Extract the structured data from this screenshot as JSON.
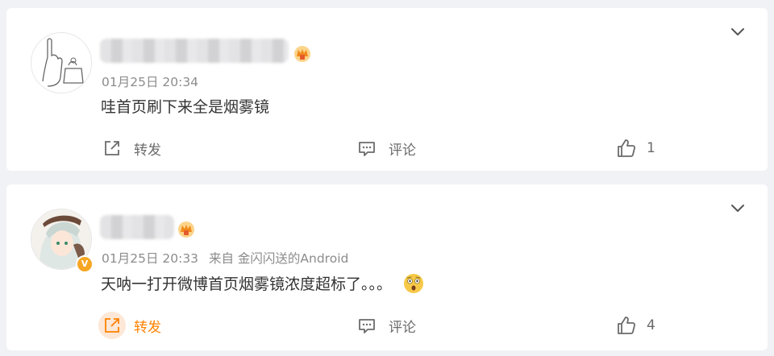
{
  "comments": [
    {
      "timestamp": "01月25日 20:34",
      "source": "",
      "text": "哇首页刷下来全是烟雾镜",
      "actions": {
        "repost": "转发",
        "comment": "评论",
        "like_count": "1"
      }
    },
    {
      "timestamp": "01月25日 20:33",
      "source": "来自 金闪闪送的Android",
      "text": "天呐一打开微博首页烟雾镜浓度超标了。。。",
      "actions": {
        "repost": "转发",
        "comment": "评论",
        "like_count": "4"
      }
    }
  ],
  "colors": {
    "accent": "#ff8200",
    "muted_text": "#8c8c8c",
    "body_text": "#333333",
    "background": "#f1f2f5"
  },
  "icons": [
    "expand-chevron-icon",
    "repost-icon",
    "comment-icon",
    "like-thumb-icon",
    "vip-crown-icon",
    "verified-badge-icon",
    "shocked-emoji-icon"
  ]
}
